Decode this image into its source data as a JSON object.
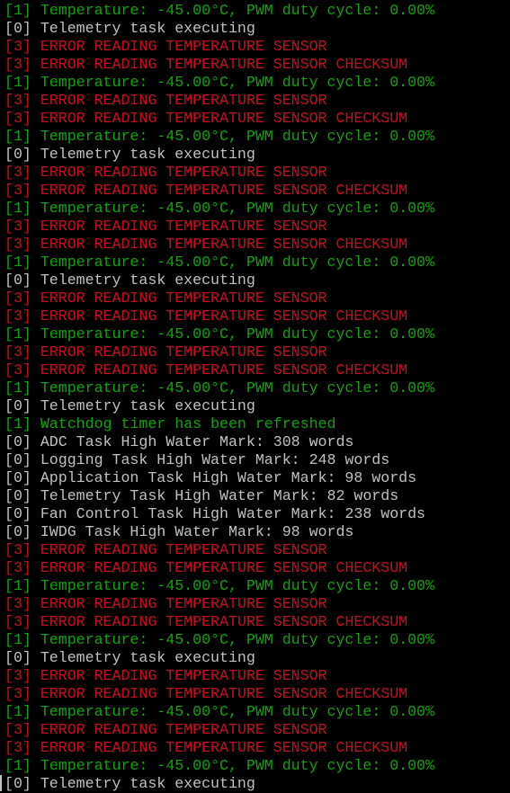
{
  "terminal": {
    "colors": {
      "background": "#000000",
      "level_0": "#c0c0c0",
      "level_1": "#13a10e",
      "level_3": "#c50f1f"
    },
    "lines": [
      {
        "level": 1,
        "text": "[1] Temperature: -45.00°C, PWM duty cycle: 0.00%"
      },
      {
        "level": 0,
        "text": "[0] Telemetry task executing"
      },
      {
        "level": 3,
        "text": "[3] ERROR READING TEMPERATURE SENSOR"
      },
      {
        "level": 3,
        "text": "[3] ERROR READING TEMPERATURE SENSOR CHECKSUM"
      },
      {
        "level": 1,
        "text": "[1] Temperature: -45.00°C, PWM duty cycle: 0.00%"
      },
      {
        "level": 3,
        "text": "[3] ERROR READING TEMPERATURE SENSOR"
      },
      {
        "level": 3,
        "text": "[3] ERROR READING TEMPERATURE SENSOR CHECKSUM"
      },
      {
        "level": 1,
        "text": "[1] Temperature: -45.00°C, PWM duty cycle: 0.00%"
      },
      {
        "level": 0,
        "text": "[0] Telemetry task executing"
      },
      {
        "level": 3,
        "text": "[3] ERROR READING TEMPERATURE SENSOR"
      },
      {
        "level": 3,
        "text": "[3] ERROR READING TEMPERATURE SENSOR CHECKSUM"
      },
      {
        "level": 1,
        "text": "[1] Temperature: -45.00°C, PWM duty cycle: 0.00%"
      },
      {
        "level": 3,
        "text": "[3] ERROR READING TEMPERATURE SENSOR"
      },
      {
        "level": 3,
        "text": "[3] ERROR READING TEMPERATURE SENSOR CHECKSUM"
      },
      {
        "level": 1,
        "text": "[1] Temperature: -45.00°C, PWM duty cycle: 0.00%"
      },
      {
        "level": 0,
        "text": "[0] Telemetry task executing"
      },
      {
        "level": 3,
        "text": "[3] ERROR READING TEMPERATURE SENSOR"
      },
      {
        "level": 3,
        "text": "[3] ERROR READING TEMPERATURE SENSOR CHECKSUM"
      },
      {
        "level": 1,
        "text": "[1] Temperature: -45.00°C, PWM duty cycle: 0.00%"
      },
      {
        "level": 3,
        "text": "[3] ERROR READING TEMPERATURE SENSOR"
      },
      {
        "level": 3,
        "text": "[3] ERROR READING TEMPERATURE SENSOR CHECKSUM"
      },
      {
        "level": 1,
        "text": "[1] Temperature: -45.00°C, PWM duty cycle: 0.00%"
      },
      {
        "level": 0,
        "text": "[0] Telemetry task executing"
      },
      {
        "level": 1,
        "text": "[1] Watchdog timer has been refreshed"
      },
      {
        "level": 0,
        "text": "[0] ADC Task High Water Mark: 308 words"
      },
      {
        "level": 0,
        "text": "[0] Logging Task High Water Mark: 248 words"
      },
      {
        "level": 0,
        "text": "[0] Application Task High Water Mark: 98 words"
      },
      {
        "level": 0,
        "text": "[0] Telemetry Task High Water Mark: 82 words"
      },
      {
        "level": 0,
        "text": "[0] Fan Control Task High Water Mark: 238 words"
      },
      {
        "level": 0,
        "text": "[0] IWDG Task High Water Mark: 98 words"
      },
      {
        "level": 3,
        "text": "[3] ERROR READING TEMPERATURE SENSOR"
      },
      {
        "level": 3,
        "text": "[3] ERROR READING TEMPERATURE SENSOR CHECKSUM"
      },
      {
        "level": 1,
        "text": "[1] Temperature: -45.00°C, PWM duty cycle: 0.00%"
      },
      {
        "level": 3,
        "text": "[3] ERROR READING TEMPERATURE SENSOR"
      },
      {
        "level": 3,
        "text": "[3] ERROR READING TEMPERATURE SENSOR CHECKSUM"
      },
      {
        "level": 1,
        "text": "[1] Temperature: -45.00°C, PWM duty cycle: 0.00%"
      },
      {
        "level": 0,
        "text": "[0] Telemetry task executing"
      },
      {
        "level": 3,
        "text": "[3] ERROR READING TEMPERATURE SENSOR"
      },
      {
        "level": 3,
        "text": "[3] ERROR READING TEMPERATURE SENSOR CHECKSUM"
      },
      {
        "level": 1,
        "text": "[1] Temperature: -45.00°C, PWM duty cycle: 0.00%"
      },
      {
        "level": 3,
        "text": "[3] ERROR READING TEMPERATURE SENSOR"
      },
      {
        "level": 3,
        "text": "[3] ERROR READING TEMPERATURE SENSOR CHECKSUM"
      },
      {
        "level": 1,
        "text": "[1] Temperature: -45.00°C, PWM duty cycle: 0.00%"
      },
      {
        "level": 0,
        "text": "[0] Telemetry task executing"
      }
    ]
  }
}
